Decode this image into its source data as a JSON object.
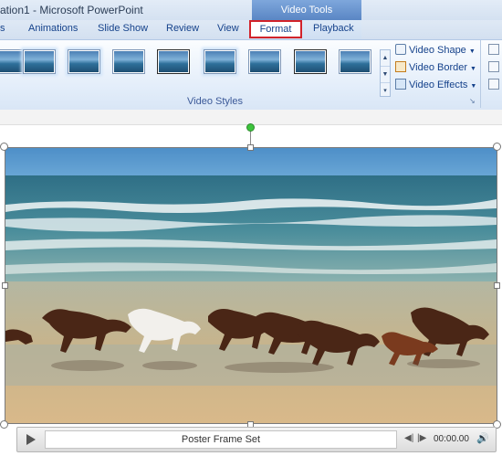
{
  "window": {
    "title": "ation1  -  Microsoft PowerPoint",
    "context_tab_group": "Video Tools"
  },
  "tabs": {
    "visible": [
      {
        "label": "s",
        "name": "tab-partial"
      },
      {
        "label": "Animations",
        "name": "tab-animations"
      },
      {
        "label": "Slide Show",
        "name": "tab-slide-show"
      },
      {
        "label": "Review",
        "name": "tab-review"
      },
      {
        "label": "View",
        "name": "tab-view"
      }
    ],
    "format": "Format",
    "playback": "Playback",
    "highlight_color": "#d2232a"
  },
  "ribbon": {
    "gallery_styles": [
      "video-style-1",
      "video-style-2",
      "video-style-3",
      "video-style-4",
      "video-style-5",
      "video-style-6",
      "video-style-7",
      "video-style-8",
      "video-style-9"
    ],
    "group_label": "Video Styles",
    "commands": {
      "video_shape": "Video Shape",
      "video_border": "Video Border",
      "video_effects": "Video Effects"
    }
  },
  "playback_bar": {
    "poster_text": "Poster Frame Set",
    "time": "00:00.00",
    "icons": [
      "play-icon",
      "step-back-icon",
      "step-forward-icon",
      "volume-icon"
    ]
  },
  "video": {
    "scene": "horses running on beach",
    "rotation_handle_color": "#3cc43c"
  }
}
